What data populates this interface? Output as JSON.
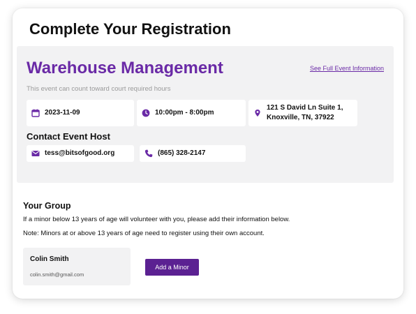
{
  "page": {
    "title": "Complete Your Registration"
  },
  "event": {
    "title": "Warehouse Management",
    "full_info_link": "See Full Event Information",
    "note": "This event can count toward court required hours",
    "date": "2023-11-09",
    "time": "10:00pm - 8:00pm",
    "location_line1": "121 S David Ln Suite 1,",
    "location_line2": "Knoxville, TN, 37922",
    "contact_heading": "Contact Event Host",
    "host_email": "tess@bitsofgood.org",
    "host_phone": "(865) 328-2147",
    "accent_color": "#6a2aa6"
  },
  "group": {
    "heading": "Your Group",
    "line1": "If a minor below 13 years of age will volunteer with you, please add their information below.",
    "line2": "Note: Minors at or above 13 years of age need to register using their own account.",
    "members": [
      {
        "name": "Colin Smith",
        "email": "colin.smith@gmail.com"
      }
    ],
    "add_button_label": "Add a Minor",
    "button_color": "#5b2192"
  },
  "icons": {
    "date": "calendar-icon",
    "time": "clock-icon",
    "location": "map-pin-icon",
    "email": "envelope-icon",
    "phone": "phone-icon"
  }
}
